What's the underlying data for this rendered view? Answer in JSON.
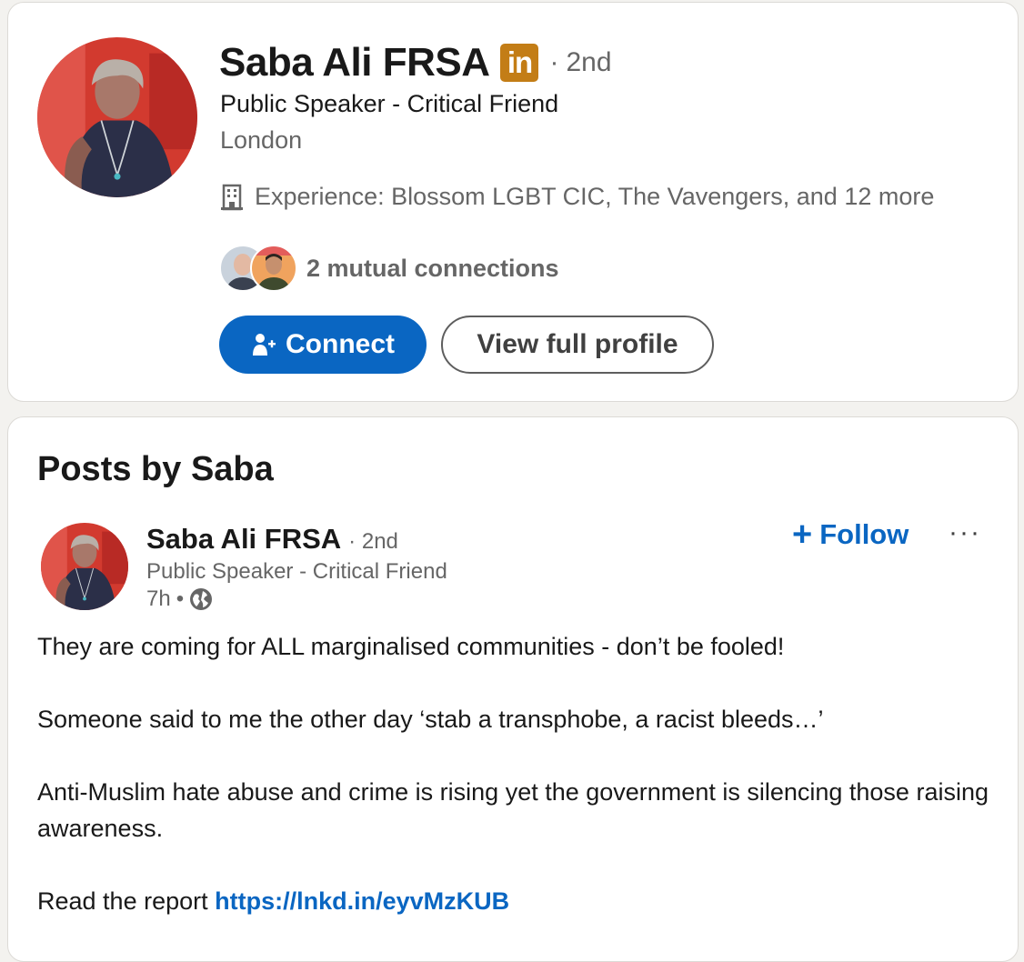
{
  "profile": {
    "name": "Saba Ali FRSA",
    "badge": "in",
    "degree": "2nd",
    "headline": "Public Speaker - Critical Friend",
    "location": "London",
    "experience": "Experience: Blossom LGBT CIC, The Vavengers, and 12 more",
    "mutual_connections": "2 mutual connections",
    "connect_label": "Connect",
    "view_profile_label": "View full profile"
  },
  "posts": {
    "title": "Posts by Saba",
    "author": "Saba Ali FRSA",
    "degree": "2nd",
    "headline": "Public Speaker - Critical Friend",
    "time": "7h",
    "follow_label": "Follow",
    "more_label": "···",
    "paragraphs": [
      "They are coming for ALL marginalised communities - don’t be fooled!",
      "Someone said to me the other day ‘stab a transphobe, a racist bleeds…’",
      "Anti-Muslim hate abuse and crime is rising yet the government is silencing those raising awareness."
    ],
    "report_prefix": "Read the report ",
    "report_link": "https://lnkd.in/eyvMzKUB"
  },
  "colors": {
    "accent": "#0a66c2",
    "premium_badge": "#c37d16",
    "muted_text": "#666666"
  },
  "icons": {
    "linkedin_badge": "linkedin-premium-icon",
    "experience": "building-icon",
    "connect": "add-person-icon",
    "follow": "plus-icon",
    "more": "ellipsis-icon",
    "visibility": "globe-icon"
  }
}
